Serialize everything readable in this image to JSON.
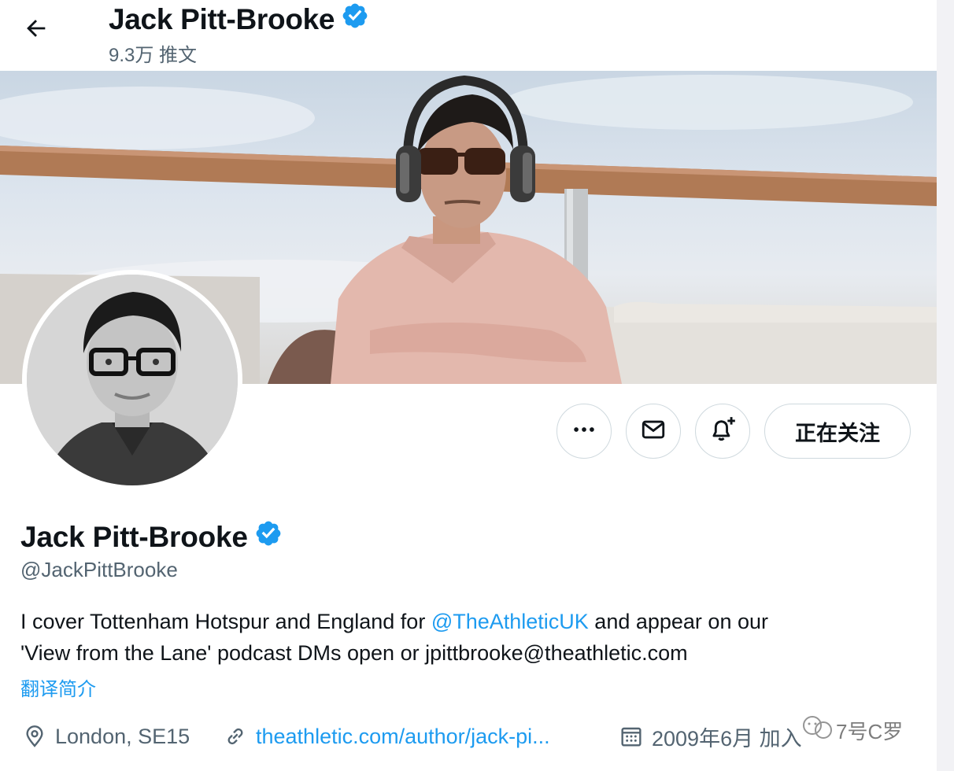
{
  "header": {
    "name": "Jack Pitt-Brooke",
    "tweet_count": "9.3万 推文"
  },
  "actions": {
    "follow_label": "正在关注"
  },
  "profile": {
    "name": "Jack Pitt-Brooke",
    "handle": "@JackPittBrooke",
    "bio": {
      "line1_before": "I cover Tottenham Hotspur and England for ",
      "line1_mention": "@TheAthleticUK",
      "line1_after": " and appear on our",
      "line2": "'View from the Lane' podcast DMs open or jpittbrooke@theathletic.com"
    },
    "translate_label": "翻译简介",
    "location": "London, SE15",
    "website": "theathletic.com/author/jack-pi...",
    "joined": "2009年6月 加入"
  },
  "watermark": {
    "text": "7号C罗"
  },
  "icons": {
    "back": "arrow-left-icon",
    "verified": "verified-badge-icon",
    "more": "more-horizontal-icon",
    "message": "envelope-icon",
    "notify": "bell-plus-icon",
    "location": "map-pin-icon",
    "link": "link-icon",
    "calendar": "calendar-icon"
  },
  "colors": {
    "accent": "#1d9bf0",
    "secondary_text": "#536471",
    "border": "#cfd9de"
  }
}
